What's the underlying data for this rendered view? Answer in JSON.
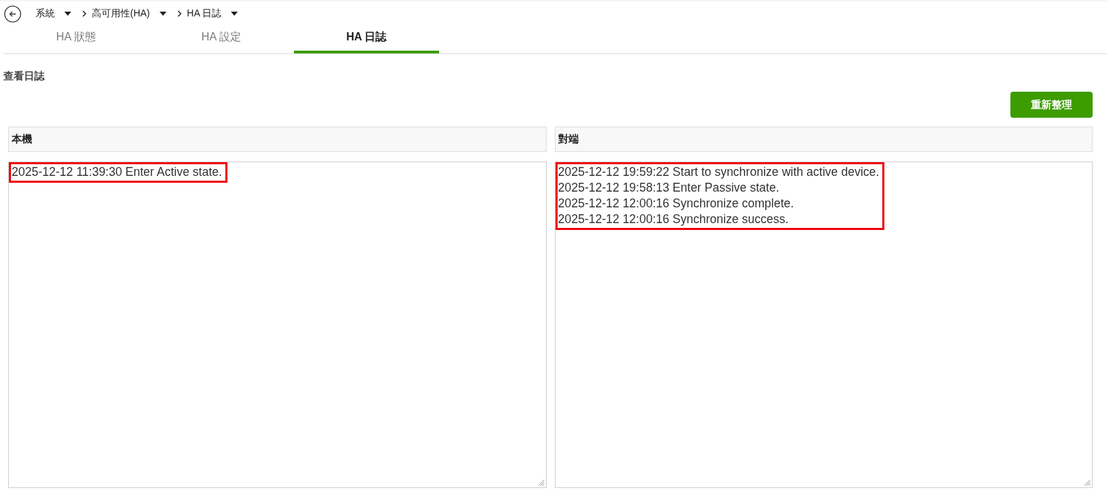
{
  "breadcrumb": [
    {
      "label": "系統"
    },
    {
      "label": "高可用性(HA)"
    },
    {
      "label": "HA 日誌"
    }
  ],
  "tabs": [
    {
      "label": "HA 狀態",
      "selected": false
    },
    {
      "label": "HA 設定",
      "selected": false
    },
    {
      "label": "HA 日誌",
      "selected": true
    }
  ],
  "section_title": "查看日誌",
  "refresh_button": "重新整理",
  "panels": [
    {
      "title": "本機",
      "highlighted": true,
      "lines": [
        "2025-12-12 11:39:30 Enter Active state."
      ]
    },
    {
      "title": "對端",
      "highlighted": true,
      "lines": [
        "2025-12-12 19:59:22 Start to synchronize with active device.",
        "2025-12-12 19:58:13 Enter Passive state.",
        "2025-12-12 12:00:16 Synchronize complete.",
        "2025-12-12 12:00:16 Synchronize success."
      ]
    }
  ]
}
